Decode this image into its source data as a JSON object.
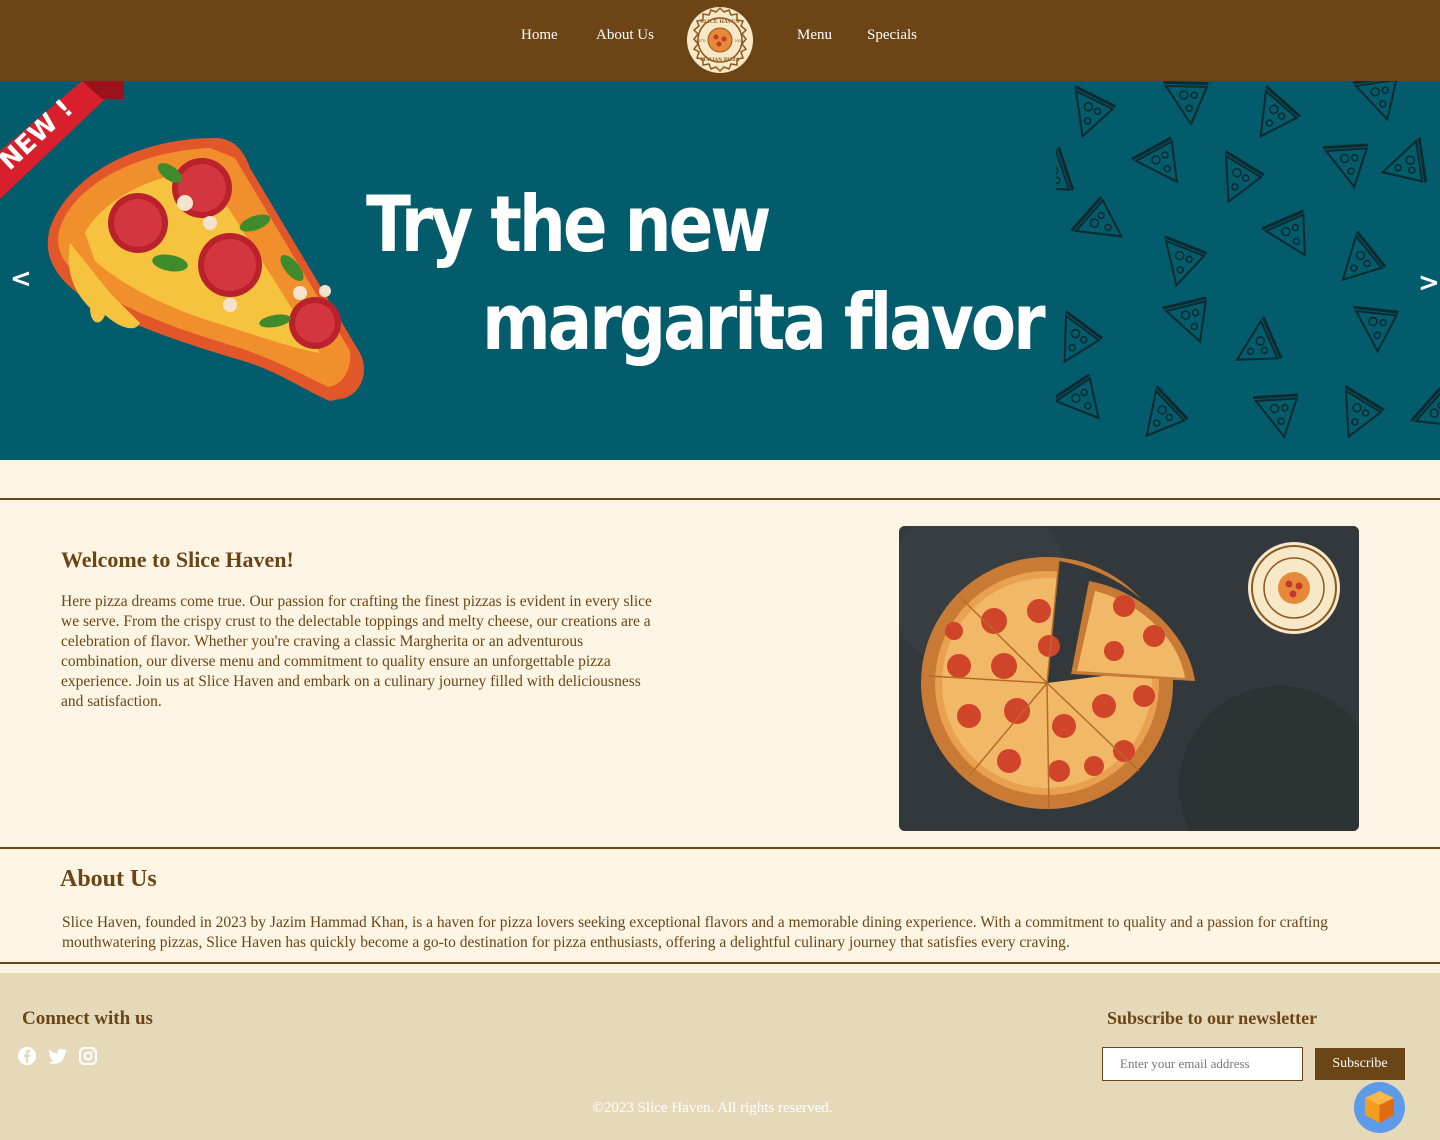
{
  "nav": {
    "links": [
      "Home",
      "About Us",
      "Menu",
      "Specials"
    ],
    "logo_text": "SLICE HAVEN · ESTD 2023 · ITALIAN PIZZA"
  },
  "hero": {
    "ribbon_text": "NEW !",
    "line1": "Try the new",
    "line2": "margarita flavor",
    "prev_label": "<",
    "next_label": ">"
  },
  "welcome": {
    "title": "Welcome to Slice Haven!",
    "text": "Here pizza dreams come true. Our passion for crafting the finest pizzas is evident in every slice we serve. From the crispy crust to the delectable toppings and melty cheese, our creations are a celebration of flavor. Whether you're craving a classic Margherita or an adventurous combination, our diverse menu and commitment to quality ensure an unforgettable pizza experience. Join us at Slice Haven and embark on a culinary journey filled with deliciousness and satisfaction."
  },
  "about": {
    "title": "About Us",
    "text": "Slice Haven, founded in 2023 by Jazim Hammad Khan, is a haven for pizza lovers seeking exceptional flavors and a memorable dining experience. With a commitment to quality and a passion for crafting mouthwatering pizzas, Slice Haven has quickly become a go-to destination for pizza enthusiasts, offering a delightful culinary journey that satisfies every craving."
  },
  "footer": {
    "connect_title": "Connect with us",
    "social": [
      "facebook-icon",
      "twitter-icon",
      "instagram-icon"
    ],
    "newsletter_title": "Subscribe to our newsletter",
    "email_placeholder": "Enter your email address",
    "subscribe_label": "Subscribe",
    "copyright": "©2023 Slice Haven. All rights reserved."
  },
  "colors": {
    "brand_brown": "#6b4516",
    "hero_teal": "#035c6b",
    "page_cream": "#fdf5e4",
    "footer_beige": "#e6d9ba"
  }
}
